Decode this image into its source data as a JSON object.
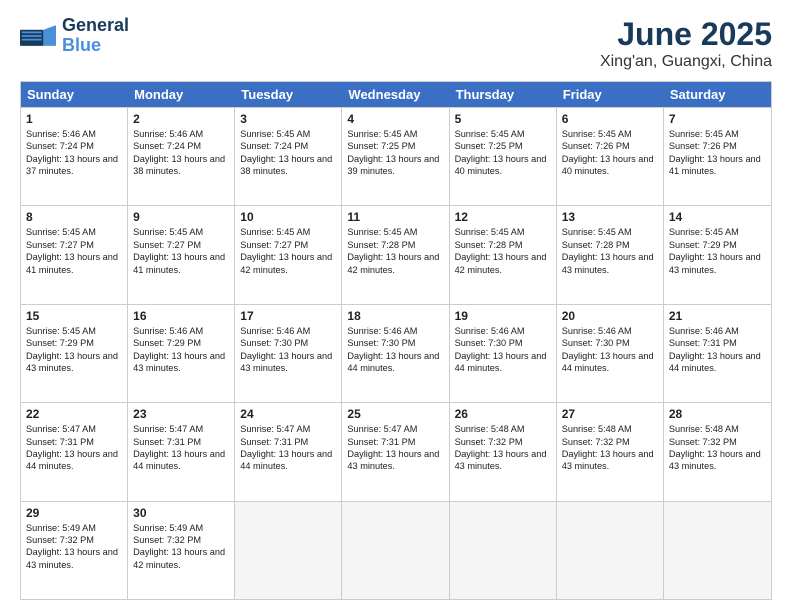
{
  "header": {
    "logo_line1": "General",
    "logo_line2": "Blue",
    "title": "June 2025",
    "subtitle": "Xing'an, Guangxi, China"
  },
  "days_of_week": [
    "Sunday",
    "Monday",
    "Tuesday",
    "Wednesday",
    "Thursday",
    "Friday",
    "Saturday"
  ],
  "weeks": [
    [
      {
        "day": "1",
        "sunrise": "5:46 AM",
        "sunset": "7:24 PM",
        "daylight": "13 hours and 37 minutes."
      },
      {
        "day": "2",
        "sunrise": "5:46 AM",
        "sunset": "7:24 PM",
        "daylight": "13 hours and 38 minutes."
      },
      {
        "day": "3",
        "sunrise": "5:45 AM",
        "sunset": "7:24 PM",
        "daylight": "13 hours and 38 minutes."
      },
      {
        "day": "4",
        "sunrise": "5:45 AM",
        "sunset": "7:25 PM",
        "daylight": "13 hours and 39 minutes."
      },
      {
        "day": "5",
        "sunrise": "5:45 AM",
        "sunset": "7:25 PM",
        "daylight": "13 hours and 40 minutes."
      },
      {
        "day": "6",
        "sunrise": "5:45 AM",
        "sunset": "7:26 PM",
        "daylight": "13 hours and 40 minutes."
      },
      {
        "day": "7",
        "sunrise": "5:45 AM",
        "sunset": "7:26 PM",
        "daylight": "13 hours and 41 minutes."
      }
    ],
    [
      {
        "day": "8",
        "sunrise": "5:45 AM",
        "sunset": "7:27 PM",
        "daylight": "13 hours and 41 minutes."
      },
      {
        "day": "9",
        "sunrise": "5:45 AM",
        "sunset": "7:27 PM",
        "daylight": "13 hours and 41 minutes."
      },
      {
        "day": "10",
        "sunrise": "5:45 AM",
        "sunset": "7:27 PM",
        "daylight": "13 hours and 42 minutes."
      },
      {
        "day": "11",
        "sunrise": "5:45 AM",
        "sunset": "7:28 PM",
        "daylight": "13 hours and 42 minutes."
      },
      {
        "day": "12",
        "sunrise": "5:45 AM",
        "sunset": "7:28 PM",
        "daylight": "13 hours and 42 minutes."
      },
      {
        "day": "13",
        "sunrise": "5:45 AM",
        "sunset": "7:28 PM",
        "daylight": "13 hours and 43 minutes."
      },
      {
        "day": "14",
        "sunrise": "5:45 AM",
        "sunset": "7:29 PM",
        "daylight": "13 hours and 43 minutes."
      }
    ],
    [
      {
        "day": "15",
        "sunrise": "5:45 AM",
        "sunset": "7:29 PM",
        "daylight": "13 hours and 43 minutes."
      },
      {
        "day": "16",
        "sunrise": "5:46 AM",
        "sunset": "7:29 PM",
        "daylight": "13 hours and 43 minutes."
      },
      {
        "day": "17",
        "sunrise": "5:46 AM",
        "sunset": "7:30 PM",
        "daylight": "13 hours and 43 minutes."
      },
      {
        "day": "18",
        "sunrise": "5:46 AM",
        "sunset": "7:30 PM",
        "daylight": "13 hours and 44 minutes."
      },
      {
        "day": "19",
        "sunrise": "5:46 AM",
        "sunset": "7:30 PM",
        "daylight": "13 hours and 44 minutes."
      },
      {
        "day": "20",
        "sunrise": "5:46 AM",
        "sunset": "7:30 PM",
        "daylight": "13 hours and 44 minutes."
      },
      {
        "day": "21",
        "sunrise": "5:46 AM",
        "sunset": "7:31 PM",
        "daylight": "13 hours and 44 minutes."
      }
    ],
    [
      {
        "day": "22",
        "sunrise": "5:47 AM",
        "sunset": "7:31 PM",
        "daylight": "13 hours and 44 minutes."
      },
      {
        "day": "23",
        "sunrise": "5:47 AM",
        "sunset": "7:31 PM",
        "daylight": "13 hours and 44 minutes."
      },
      {
        "day": "24",
        "sunrise": "5:47 AM",
        "sunset": "7:31 PM",
        "daylight": "13 hours and 44 minutes."
      },
      {
        "day": "25",
        "sunrise": "5:47 AM",
        "sunset": "7:31 PM",
        "daylight": "13 hours and 43 minutes."
      },
      {
        "day": "26",
        "sunrise": "5:48 AM",
        "sunset": "7:32 PM",
        "daylight": "13 hours and 43 minutes."
      },
      {
        "day": "27",
        "sunrise": "5:48 AM",
        "sunset": "7:32 PM",
        "daylight": "13 hours and 43 minutes."
      },
      {
        "day": "28",
        "sunrise": "5:48 AM",
        "sunset": "7:32 PM",
        "daylight": "13 hours and 43 minutes."
      }
    ],
    [
      {
        "day": "29",
        "sunrise": "5:49 AM",
        "sunset": "7:32 PM",
        "daylight": "13 hours and 43 minutes."
      },
      {
        "day": "30",
        "sunrise": "5:49 AM",
        "sunset": "7:32 PM",
        "daylight": "13 hours and 42 minutes."
      },
      null,
      null,
      null,
      null,
      null
    ]
  ]
}
